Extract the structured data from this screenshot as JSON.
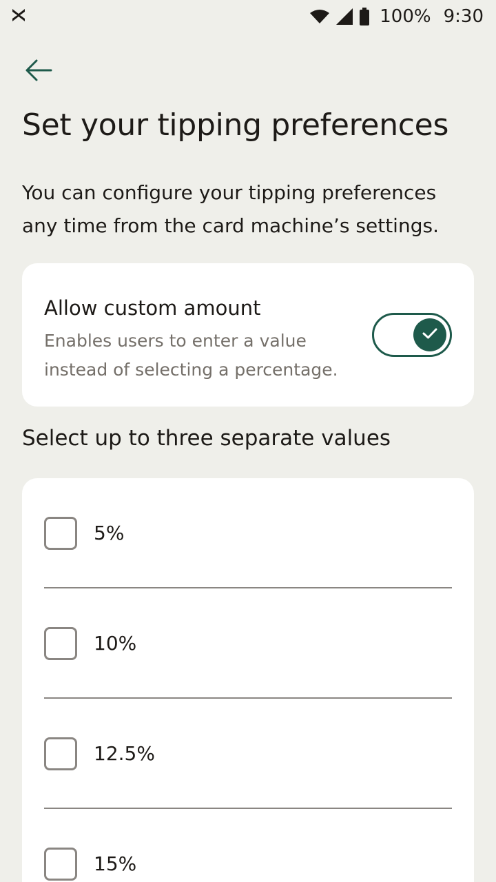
{
  "status_bar": {
    "battery_percent": "100%",
    "time": "9:30"
  },
  "header": {
    "title": "Set your tipping preferences",
    "description": "You can configure your tipping preferences any time from the card machine’s settings."
  },
  "custom_amount": {
    "title": "Allow custom amount",
    "description": "Enables users to enter a value instead of selecting a percentage.",
    "enabled": true
  },
  "values_section": {
    "label": "Select up to three separate values",
    "options": [
      {
        "label": "5%",
        "checked": false
      },
      {
        "label": "10%",
        "checked": false
      },
      {
        "label": "12.5%",
        "checked": false
      },
      {
        "label": "15%",
        "checked": false
      }
    ]
  },
  "colors": {
    "background": "#efefea",
    "accent": "#1e5a4b",
    "muted_text": "#75706a"
  }
}
